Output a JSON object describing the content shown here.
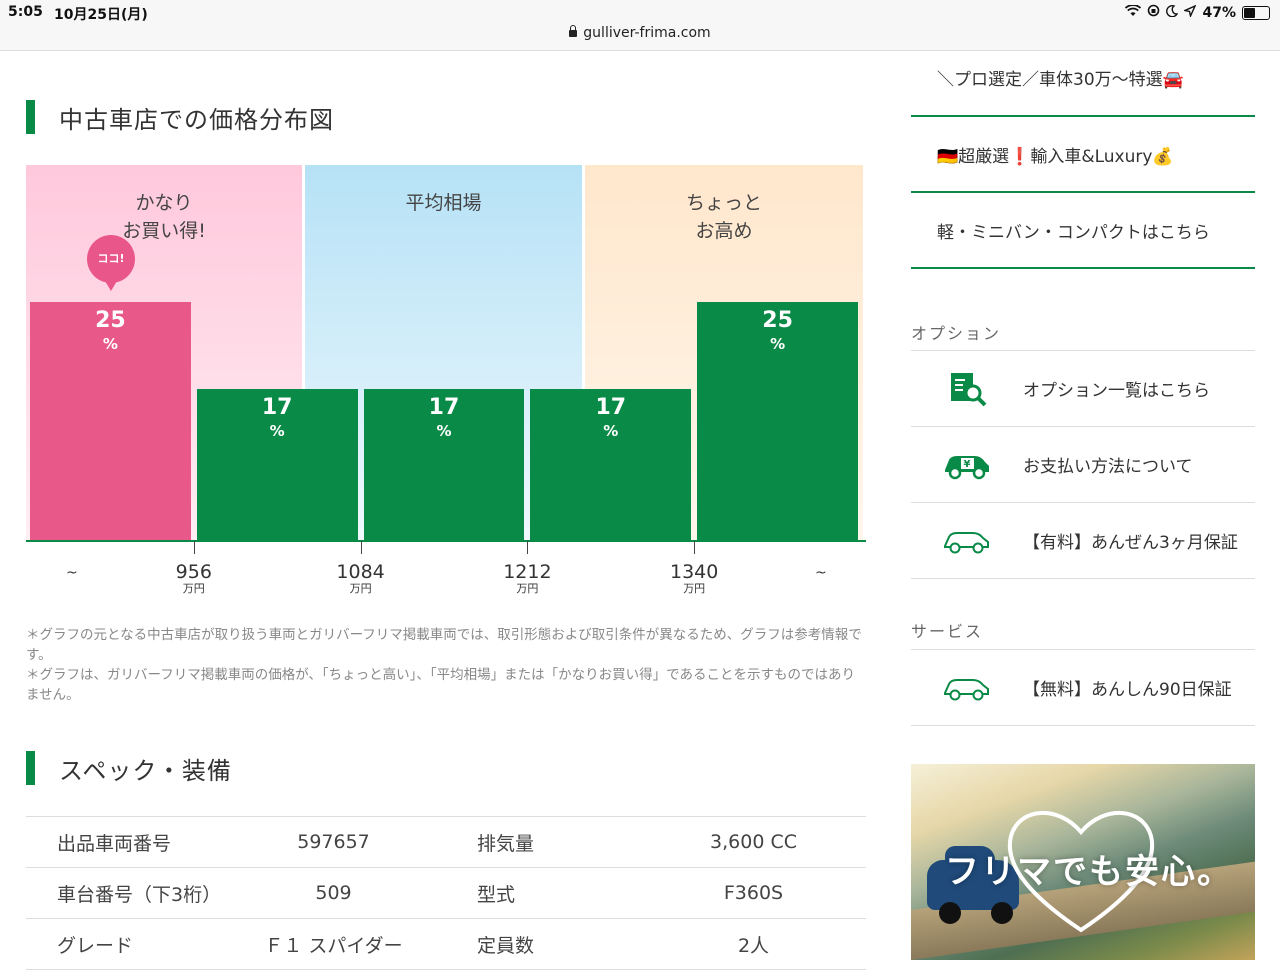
{
  "statusbar": {
    "time": "5:05",
    "date": "10月25日(月)",
    "url": "gulliver-frima.com",
    "battery": "47%"
  },
  "price_section": {
    "title": "中古車店での価格分布図",
    "zones": [
      {
        "label": "かなり\nお買い得!",
        "color": "#ffc8dc"
      },
      {
        "label": "平均相場",
        "color": "#b6e2f6"
      },
      {
        "label": "ちょっと\nお高め",
        "color": "#ffe7cc"
      }
    ],
    "marker_label": "ココ!",
    "notes": [
      "＊グラフの元となる中古車店が取り扱う車両とガリバーフリマ掲載車両では、取引形態および取引条件が異なるため、グラフは参考情報です。",
      "＊グラフは、ガリバーフリマ掲載車両の価格が、「ちょっと高い」、「平均相場」または「かなりお買い得」であることを示すものではありません。"
    ]
  },
  "chart_data": {
    "type": "bar",
    "categories": [
      "~956",
      "956~1084",
      "1084~1212",
      "1212~1340",
      "1340~"
    ],
    "values": [
      25,
      17,
      17,
      17,
      25
    ],
    "unit": "%",
    "highlight_index": 0,
    "colors": {
      "highlight": "#e8598a",
      "default": "#0a8a47"
    },
    "x_ticks": [
      "956",
      "1084",
      "1212",
      "1340"
    ],
    "x_tick_unit": "万円",
    "x_edge_labels": [
      "~",
      "~"
    ],
    "ylim": [
      0,
      30
    ]
  },
  "spec_section": {
    "title": "スペック・装備",
    "rows": [
      [
        "出品車両番号",
        "597657",
        "排気量",
        "3,600 CC"
      ],
      [
        "車台番号（下3桁）",
        "509",
        "型式",
        "F360S"
      ],
      [
        "グレード",
        "Ｆ１ スパイダー",
        "定員数",
        "2人"
      ]
    ]
  },
  "sidebar": {
    "links": [
      "＼プロ選定／車体30万〜特選🚘",
      "🇩🇪超厳選❗️輸入車&Luxury💰",
      "軽・ミニバン・コンパクトはこちら"
    ],
    "options_title": "オプション",
    "options": [
      {
        "icon": "document-search-icon",
        "label": "オプション一覧はこちら"
      },
      {
        "icon": "car-yen-icon",
        "label": "お支払い方法について"
      },
      {
        "icon": "car-outline-icon",
        "label": "【有料】あんぜん3ヶ月保証"
      }
    ],
    "service_title": "サービス",
    "services": [
      {
        "icon": "car-outline-icon",
        "label": "【無料】あんしん90日保証"
      }
    ],
    "banner_text": "フリマでも安心。"
  }
}
